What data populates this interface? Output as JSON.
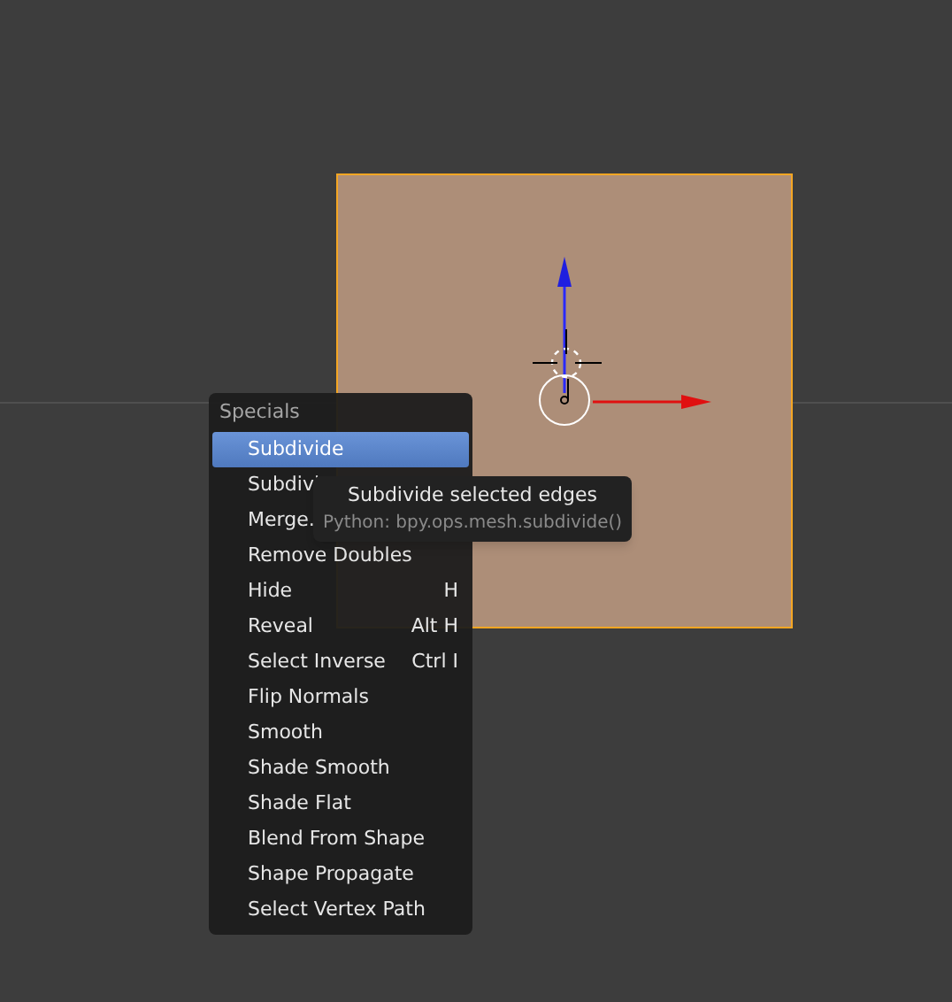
{
  "menu": {
    "title": "Specials",
    "items": [
      {
        "label": "Subdivide",
        "selected": true
      },
      {
        "label": "Subdivi",
        "selected": false
      },
      {
        "label": "Merge.",
        "selected": false
      },
      {
        "label": "Remove Doubles",
        "selected": false
      },
      {
        "label": "Hide",
        "shortcut": "H",
        "selected": false
      },
      {
        "label": "Reveal",
        "shortcut": "Alt H",
        "selected": false
      },
      {
        "label": "Select Inverse",
        "shortcut": "Ctrl I",
        "selected": false
      },
      {
        "label": "Flip Normals",
        "selected": false
      },
      {
        "label": "Smooth",
        "selected": false
      },
      {
        "label": "Shade Smooth",
        "selected": false
      },
      {
        "label": "Shade Flat",
        "selected": false
      },
      {
        "label": "Blend From Shape",
        "selected": false
      },
      {
        "label": "Shape Propagate",
        "selected": false
      },
      {
        "label": "Select Vertex Path",
        "selected": false
      }
    ]
  },
  "tooltip": {
    "description": "Subdivide selected edges",
    "python": "Python: bpy.ops.mesh.subdivide()"
  }
}
